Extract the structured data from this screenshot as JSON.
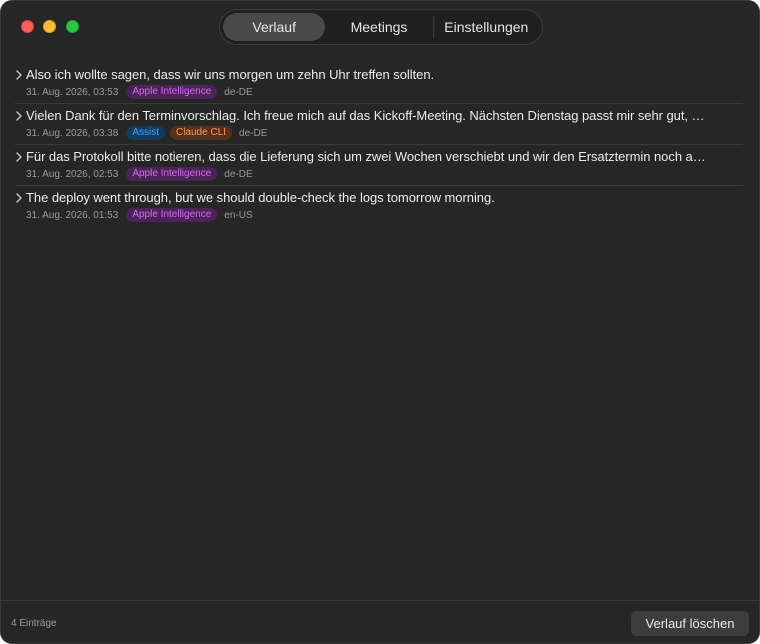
{
  "tabs": [
    {
      "label": "Verlauf"
    },
    {
      "label": "Meetings"
    },
    {
      "label": "Einstellungen"
    }
  ],
  "entries": [
    {
      "text": "Also ich wollte sagen, dass wir uns morgen um zehn Uhr treffen sollten.",
      "date": "31. Aug. 2026, 03:53",
      "badges": [
        "Apple Intelligence"
      ],
      "lang": "de-DE"
    },
    {
      "text": "Vielen Dank für den Terminvorschlag. Ich freue mich auf das Kickoff-Meeting. Nächsten Dienstag passt mir sehr gut, …",
      "date": "31. Aug. 2026, 03:38",
      "badges": [
        "Assist",
        "Claude CLI"
      ],
      "lang": "de-DE"
    },
    {
      "text": "Für das Protokoll bitte notieren, dass die Lieferung sich um zwei Wochen verschiebt und wir den Ersatztermin noch a…",
      "date": "31. Aug. 2026, 02:53",
      "badges": [
        "Apple Intelligence"
      ],
      "lang": "de-DE"
    },
    {
      "text": "The deploy went through, but we should double-check the logs tomorrow morning.",
      "date": "31. Aug. 2026, 01:53",
      "badges": [
        "Apple Intelligence"
      ],
      "lang": "en-US"
    }
  ],
  "footer": {
    "count": "4 Einträge",
    "clear_label": "Verlauf löschen"
  },
  "colors": {
    "window_bg": "#262626",
    "badge_apple_intelligence": "#d869f2",
    "badge_assist": "#3ea6ff",
    "badge_claude_cli": "#ff9a4a"
  },
  "icons": {
    "close": "close-button",
    "minimize": "minimize-button",
    "zoom": "zoom-button",
    "entry_chevron": "chevron-right-icon"
  }
}
